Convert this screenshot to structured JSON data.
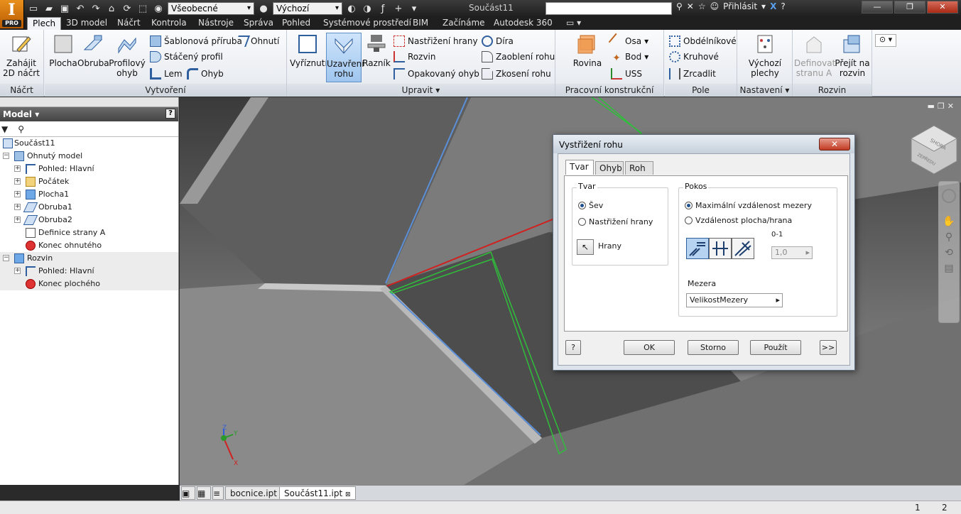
{
  "app": {
    "logo_letter": "I",
    "logo_sub": "PRO",
    "style_combo": "Všeobecné",
    "material_combo": "Výchozí",
    "document_title": "Součást11",
    "login": "Přihlásit"
  },
  "ribbon_tabs": [
    "Plech",
    "3D model",
    "Náčrt",
    "Kontrola",
    "Nástroje",
    "Správa",
    "Pohled",
    "Systémové prostředí",
    "BIM",
    "Začínáme",
    "Autodesk 360"
  ],
  "ribbon": {
    "nacrt": {
      "title": "Náčrt",
      "start": "Zahájit 2D náčrt"
    },
    "vytvoreni": {
      "title": "Vytvoření",
      "plocha": "Plocha",
      "obruba": "Obruba",
      "profilovy_ohyb": "Profilový ohyb",
      "sablonova_priruba": "Šablonová příruba",
      "staceny_profil": "Stáčený profil",
      "lem": "Lem",
      "ohnuti": "Ohnutí",
      "ohyb": "Ohyb"
    },
    "upravit": {
      "title": "Upravit",
      "vyriznuti": "Vyříznutí",
      "uzavreni_rohu": "Uzavření rohu",
      "raznik": "Razník",
      "nastrizeni_hrany": "Nastřižení hrany",
      "rozvin": "Rozvin",
      "opakovany_ohyb": "Opakovaný ohyb",
      "dira": "Díra",
      "zaobleni_rohu": "Zaoblení rohu",
      "zkoseni_rohu": "Zkosení rohu"
    },
    "pracovni": {
      "title": "Pracovní konstrukční prvky",
      "rovina": "Rovina",
      "osa": "Osa",
      "bod": "Bod",
      "uss": "USS"
    },
    "pole": {
      "title": "Pole",
      "obdelnikove": "Obdélníkové",
      "kruhove": "Kruhové",
      "zrcadlit": "Zrcadlit"
    },
    "nastaveni": {
      "title": "Nastavení",
      "vychozi_plechy": "Výchozí plechy"
    },
    "rozvin_panel": {
      "title": "Rozvin",
      "definovat": "Definovat stranu A",
      "prejit": "Přejít na rozvin"
    }
  },
  "browser": {
    "title": "Model",
    "root": "Součást11",
    "items": [
      {
        "label": "Ohnutý model",
        "indent": 1,
        "shade": false,
        "expand": "−",
        "icon": "folded-model-icon"
      },
      {
        "label": "Pohled: Hlavní",
        "indent": 2,
        "shade": false,
        "expand": "+",
        "icon": "view-icon"
      },
      {
        "label": "Počátek",
        "indent": 2,
        "shade": false,
        "expand": "+",
        "icon": "folder-icon"
      },
      {
        "label": "Plocha1",
        "indent": 2,
        "shade": false,
        "expand": "+",
        "icon": "face-icon"
      },
      {
        "label": "Obruba1",
        "indent": 2,
        "shade": false,
        "expand": "+",
        "icon": "flange-icon"
      },
      {
        "label": "Obruba2",
        "indent": 2,
        "shade": false,
        "expand": "+",
        "icon": "flange-icon"
      },
      {
        "label": "Definice strany A",
        "indent": 2,
        "shade": false,
        "expand": "",
        "icon": "side-a-icon"
      },
      {
        "label": "Konec ohnutého",
        "indent": 2,
        "shade": false,
        "expand": "",
        "icon": "end-of-part-icon"
      },
      {
        "label": "Rozvin",
        "indent": 1,
        "shade": true,
        "expand": "−",
        "icon": "flat-pattern-icon"
      },
      {
        "label": "Pohled: Hlavní",
        "indent": 2,
        "shade": true,
        "expand": "+",
        "icon": "view-icon"
      },
      {
        "label": "Konec plochého",
        "indent": 2,
        "shade": true,
        "expand": "",
        "icon": "end-of-part-icon"
      }
    ]
  },
  "viewcube": {
    "top": "SHORA",
    "front": "ZEPŘEDU"
  },
  "dialog": {
    "title": "Vystřižení rohu",
    "tabs": [
      "Tvar",
      "Ohyb",
      "Roh"
    ],
    "tvar_group": "Tvar",
    "opt_sev": "Šev",
    "opt_nastrizeni": "Nastřižení hrany",
    "hrany": "Hrany",
    "pokos_group": "Pokos",
    "opt_max": "Maximální vzdálenost mezery",
    "opt_plocha": "Vzdálenost plocha/hrana",
    "ratio_label": "0-1",
    "spinner_value": "1,0",
    "mezera_label": "Mezera",
    "mezera_value": "VelikostMezery",
    "ok": "OK",
    "storno": "Storno",
    "pouzit": "Použít",
    "more": ">>"
  },
  "doc_tabs": [
    "bocnice.ipt",
    "Součást11.ipt"
  ],
  "status": {
    "page1": "1",
    "page2": "2"
  },
  "colors": {
    "accent_blue": "#5b8fd8",
    "green_edges": "#2fbf3a",
    "red_axis": "#d02020"
  }
}
